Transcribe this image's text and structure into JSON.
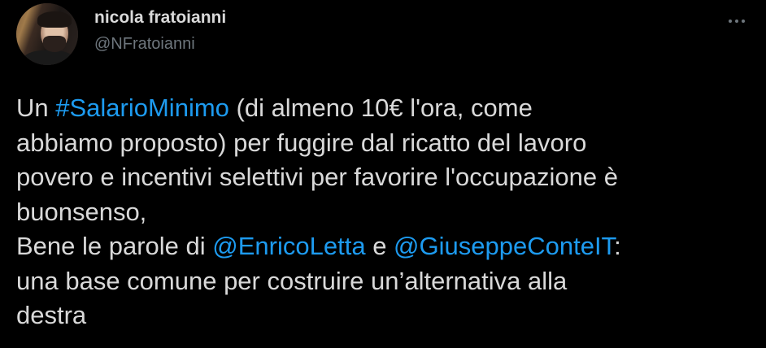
{
  "author": {
    "name": "nicola fratoianni",
    "handle": "@NFratoianni"
  },
  "tweet": {
    "line1_pre": "Un ",
    "hashtag": "#SalarioMinimo",
    "line1_post": " (di almeno 10€ l'ora, come",
    "line2": "abbiamo proposto) per fuggire dal ricatto del lavoro",
    "line3": "povero e incentivi selettivi per favorire l'occupazione è",
    "line4": "buonsenso,",
    "line5_pre": "Bene le parole di ",
    "mention1": "@EnricoLetta",
    "line5_mid": " e ",
    "mention2": "@GiuseppeConteIT",
    "line5_post": ":",
    "line6": "una base comune per costruire un’alternativa alla",
    "line7": "destra"
  },
  "colors": {
    "background": "#000000",
    "text": "#D9D9D9",
    "secondary": "#6E767D",
    "link": "#1D9BF0"
  },
  "icons": {
    "more": "more-horizontal-icon"
  }
}
